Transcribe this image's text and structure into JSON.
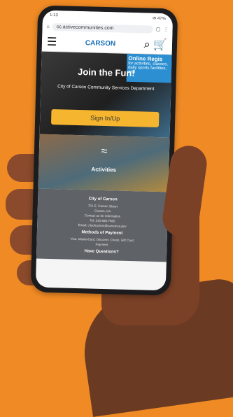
{
  "status_bar": {
    "time": "1:13",
    "indicators": "✉ 47%"
  },
  "browser": {
    "url": "cc.activecommunities.com"
  },
  "site": {
    "logo": "CARSON",
    "search_icon": "search-icon",
    "cart_icon": "cart-icon",
    "menu_icon": "menu-icon"
  },
  "hero": {
    "promo_title": "Online Regis",
    "promo_text": "for activities, classes, daily sports facilities, and",
    "title": "Join the Fun!",
    "subtitle": "City of Carson Community Services Department",
    "signin_label": "Sign In/Up"
  },
  "activities": {
    "label": "Activities"
  },
  "footer": {
    "org_title": "City of Carson",
    "address1": "701 E. Carson Street",
    "address2": "Carson, CA",
    "contact_note": "Contact us for information",
    "phone": "Tel: 310-830-7600",
    "email": "Email: cityofcarson@carsonca.gov",
    "payment_title": "Methods of Payment",
    "payment_text": "Visa, MasterCard, Discover, Check, Gift Card",
    "payment_text2": "Payment",
    "questions_title": "Have Questions?"
  }
}
